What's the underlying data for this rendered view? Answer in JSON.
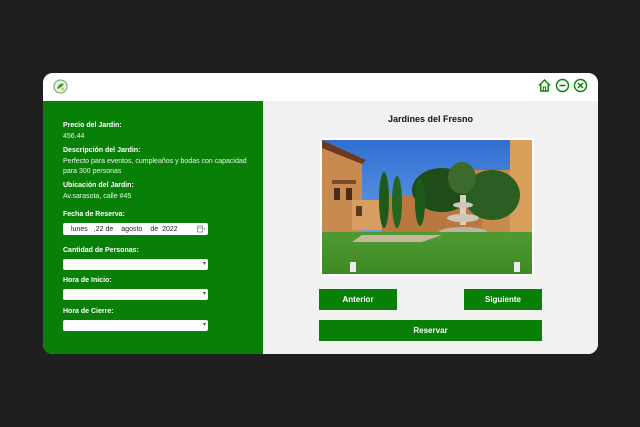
{
  "window": {
    "controls": {
      "home_icon": "home-icon",
      "minimize_icon": "minimize-icon",
      "close_icon": "close-icon"
    },
    "accent_color": "#088008"
  },
  "details": {
    "price_label": "Precio del Jardin:",
    "price_value": "456.44",
    "description_label": "Descripción del Jardin:",
    "description_value": "Perfecto para eventos, cumpleaños y bodas con capacidad para 300 personas",
    "location_label": "Ubicación del Jardin:",
    "location_value": "Av.sarasota, calle #45"
  },
  "form": {
    "date_label": "Fecha de Reserva:",
    "date": {
      "weekday": "lunes",
      "sep1": ",",
      "day": "22",
      "de1": "de",
      "month": "agosto",
      "de2": "de",
      "year": "2022"
    },
    "people_label": "Cantidad de Personas:",
    "start_label": "Hora de Inicio:",
    "end_label": "Hora de Cierre:"
  },
  "gallery": {
    "title": "Jardines del Fresno",
    "prev_label": "Anterior",
    "next_label": "Siguiente",
    "reserve_label": "Reservar"
  }
}
